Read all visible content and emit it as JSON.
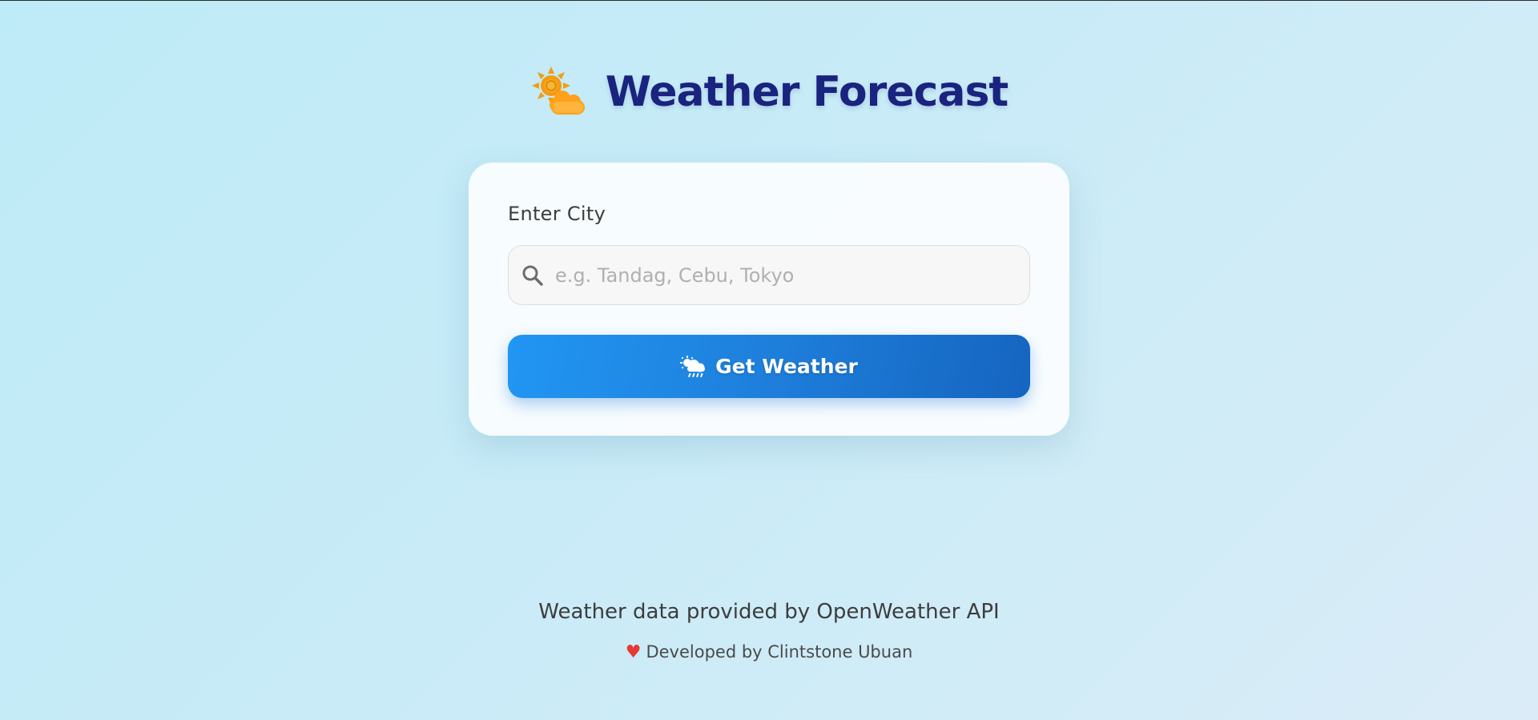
{
  "header": {
    "title": "Weather Forecast",
    "icon": "sun-behind-cloud-icon"
  },
  "form": {
    "city_label": "Enter City",
    "search_placeholder": "e.g. Tandag, Cebu, Tokyo",
    "search_value": "",
    "search_icon": "search-icon",
    "button_label": "Get Weather",
    "button_icon": "sun-rain-cloud-icon"
  },
  "footer": {
    "credit": "Weather data provided by OpenWeather API",
    "developer": "Developed by Clintstone Ubuan",
    "heart_icon": "heart-icon"
  },
  "colors": {
    "title": "#1a237e",
    "button_start": "#2196f3",
    "button_end": "#1565c0",
    "sun": "#f5a623",
    "heart": "#e53935"
  }
}
